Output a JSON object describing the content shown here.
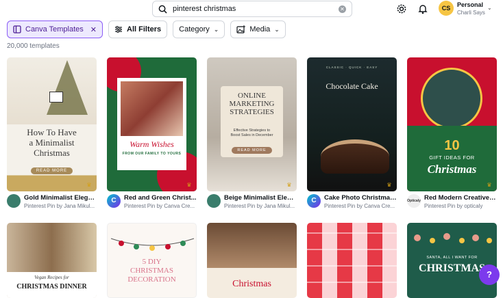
{
  "search": {
    "query": "pinterest christmas"
  },
  "header": {
    "account_initials": "CS",
    "account_name": "Personal",
    "account_user": "Charli Says"
  },
  "filters": {
    "active_label": "Canva Templates",
    "all_filters": "All Filters",
    "category": "Category",
    "media": "Media"
  },
  "results_count": "20,000 templates",
  "cards": [
    {
      "title": "Gold Minimalist Elegan...",
      "subtitle": "Pinterest Pin by Jana Mikul...",
      "thumb": {
        "line1": "How To Have",
        "line2": "a Minimalist",
        "line3": "Christmas",
        "button": "READ MORE"
      }
    },
    {
      "title": "Red and Green Christ...",
      "subtitle": "Pinterest Pin by Canva Cre...",
      "thumb": {
        "line1": "Warm Wishes",
        "line2": "FROM OUR FAMILY TO YOURS"
      }
    },
    {
      "title": "Beige Minimalist Elega...",
      "subtitle": "Pinterest Pin by Jana Mikul...",
      "thumb": {
        "line1": "ONLINE",
        "line2": "MARKETING",
        "line3": "STRATEGIES",
        "line4": "Effective Strategies to",
        "line5": "Boost Sales in December",
        "button": "READ MORE"
      }
    },
    {
      "title": "Cake Photo Christmas ...",
      "subtitle": "Pinterest Pin by Canva Cre...",
      "thumb": {
        "line0": "CLASSIC · QUICK · EASY",
        "line1": "Chocolate Cake"
      }
    },
    {
      "title": "Red Modern Creative C...",
      "subtitle": "Pinterest Pin by opticaly",
      "logo": "Opticaly",
      "thumb": {
        "line1": "10",
        "line2": "GIFT IDEAS FOR",
        "line3": "Christmas"
      }
    }
  ],
  "row2": [
    {
      "line1": "Vegan Recipes for",
      "line2": "CHRISTMAS DINNER"
    },
    {
      "line1": "5 DIY",
      "line2": "CHRISTMAS",
      "line3": "DECORATION"
    },
    {
      "line1": "Christmas"
    },
    {},
    {
      "line1": "SANTA, ALL I WANT FOR",
      "line2": "CHRISTMAS"
    }
  ],
  "help_label": "?",
  "colors": {
    "accent": "#7c3aed",
    "chip_active": "#ede9fe",
    "christmas_red": "#c8102e",
    "christmas_green": "#1f6b3a"
  }
}
